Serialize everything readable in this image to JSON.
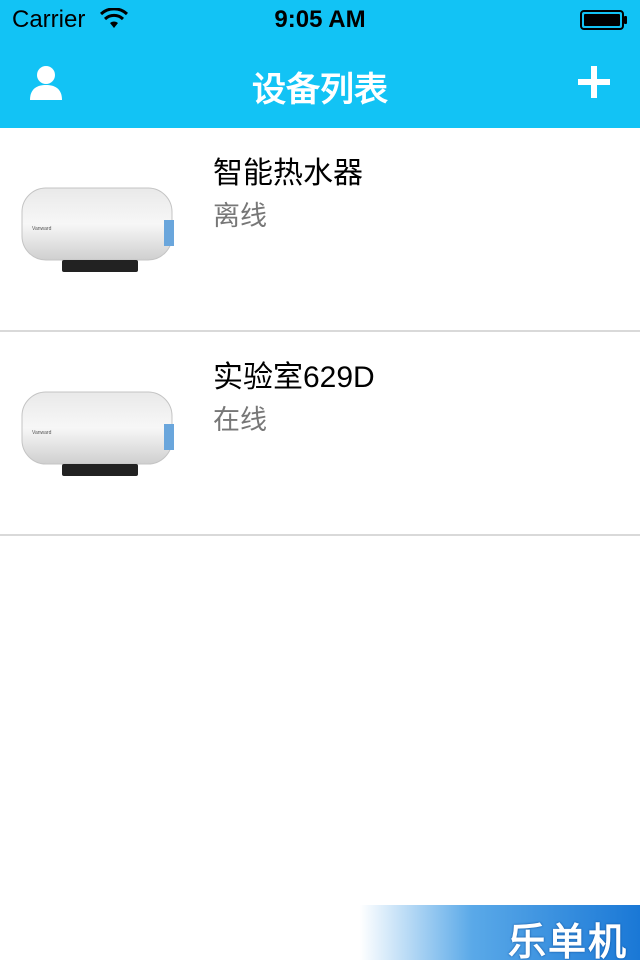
{
  "status_bar": {
    "carrier": "Carrier",
    "time": "9:05 AM"
  },
  "nav": {
    "title": "设备列表",
    "user_icon": "user-icon",
    "add_icon": "plus-icon"
  },
  "devices": [
    {
      "name": "智能热水器",
      "status": "离线",
      "image": "water-heater-image"
    },
    {
      "name": "实验室629D",
      "status": "在线",
      "image": "water-heater-image"
    }
  ],
  "watermark": {
    "text": "乐单机"
  },
  "colors": {
    "nav_bar": "#12c3f5",
    "separator": "#d9d9d9",
    "status_text": "#777777"
  }
}
